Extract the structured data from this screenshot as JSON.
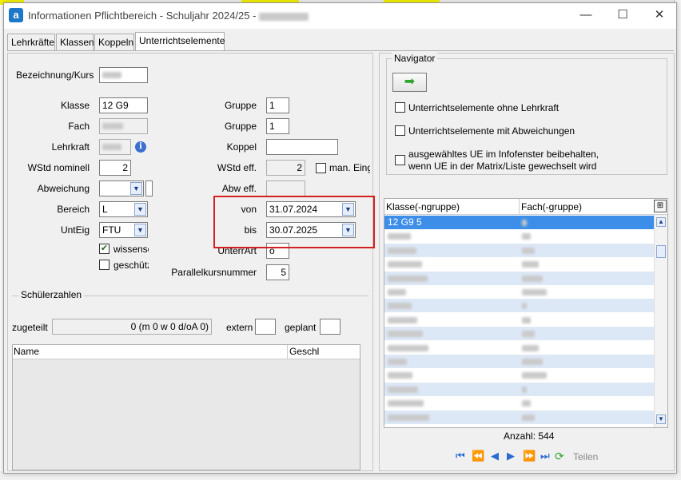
{
  "window": {
    "title": "Informationen Pflichtbereich - Schuljahr 2024/25 -",
    "app_icon": "a",
    "minimize": "—",
    "maximize": "☐",
    "close": "✕"
  },
  "tabs": [
    "Lehrkräfte",
    "Klassen",
    "Koppeln",
    "Unterrichtselemente"
  ],
  "form": {
    "bezeichnung_label": "Bezeichnung/Kurs",
    "klasse_label": "Klasse",
    "klasse_value": "12 G9",
    "fach_label": "Fach",
    "lehrkraft_label": "Lehrkraft",
    "wstd_nominell_label": "WStd nominell",
    "wstd_nominell_value": "2",
    "abweichung_label": "Abweichung",
    "bereich_label": "Bereich",
    "bereich_value": "L",
    "unteig_label": "UntEig",
    "unteig_value": "FTU",
    "wissensch_label": "wissensc",
    "wissensch_checked": "✔",
    "geschuetzt_label": "geschütz",
    "gruppe1_label": "Gruppe",
    "gruppe1_value": "1",
    "gruppe2_label": "Gruppe",
    "gruppe2_value": "1",
    "koppel_label": "Koppel",
    "wstd_eff_label": "WStd eff.",
    "wstd_eff_value": "2",
    "man_eing_label": "man. Eing",
    "abw_eff_label": "Abw eff.",
    "von_label": "von",
    "von_value": "31.07.2024",
    "bis_label": "bis",
    "bis_value": "30.07.2025",
    "unterrart_label": "UnterrArt",
    "unterrart_value": "o",
    "parallelkurs_label": "Parallelkursnummer",
    "parallelkurs_value": "5"
  },
  "schueler": {
    "group_label": "Schülerzahlen",
    "zugeteilt_label": "zugeteilt",
    "zugeteilt_value": "0 (m 0 w 0 d/oA 0)",
    "extern_label": "extern",
    "geplant_label": "geplant",
    "col_name": "Name",
    "col_geschl": "Geschl"
  },
  "navigator": {
    "group_label": "Navigator",
    "go_arrow": "➡",
    "opt1": "Unterrichtselemente ohne Lehrkraft",
    "opt2": "Unterrichtselemente mit Abweichungen",
    "opt3_line1": "ausgewähltes UE im Infofenster beibehalten,",
    "opt3_line2": "wenn UE in der Matrix/Liste gewechselt wird",
    "col_klasse": "Klasse(-ngruppe)",
    "col_fach": "Fach(-gruppe)",
    "selected_row": "12 G9 5",
    "count": "Anzahl: 544",
    "teilen_label": "Teilen"
  },
  "colors": {
    "selected_row": "#3d8ee8",
    "alt_row": "#dde8f7",
    "highlight_box": "#d42020",
    "tab_accent": "#1e78c8"
  }
}
